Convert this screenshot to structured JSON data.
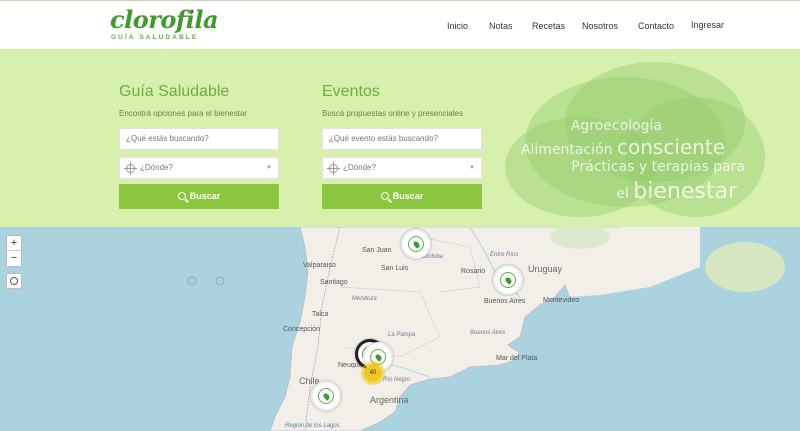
{
  "brand": {
    "name": "clorofila",
    "tagline": "GUÍA SALUDABLE",
    "color": "#3f9a2d"
  },
  "nav": {
    "items": [
      "Inicio",
      "Notas",
      "Recetas",
      "Nosotros",
      "Contacto",
      "Ingresar"
    ]
  },
  "guide": {
    "title": "Guía Saludable",
    "subtitle": "Encontrá opciones para el bienestar",
    "search_placeholder": "¿Qué estás buscando?",
    "where_placeholder": "¿Dónde?",
    "button": "Buscar"
  },
  "events": {
    "title": "Eventos",
    "subtitle": "Buscá propuestas online y presenciales",
    "search_placeholder": "¿Qué evento estás buscando?",
    "where_placeholder": "¿Dónde?",
    "button": "Buscar"
  },
  "hero_quote": {
    "line1": "Agroecología",
    "line2a": "Alimentación ",
    "line2b": "consciente",
    "line3": "Prácticas y terapias para",
    "line4a": "el ",
    "line4b": "bienestar"
  },
  "map": {
    "zoom_in": "+",
    "zoom_out": "−",
    "labels": {
      "san_juan": "San Juan",
      "cordoba": "Córdoba",
      "valparaiso": "Valparaíso",
      "san_luis": "San Luis",
      "rosario": "Rosario",
      "entre_rios": "Entre Ríos",
      "uruguay": "Uruguay",
      "santiago": "Santiago",
      "mendoza": "Mendoza",
      "buenos_aires": "Buenos Aires",
      "montevideo": "Montevideo",
      "talca": "Talca",
      "concepcion": "Concepción",
      "la_pampa": "La Pampa",
      "buenos_aires_prov": "Buenos Aires",
      "mar_del_plata": "Mar del Plata",
      "neuquen": "Neuquén",
      "chile": "Chile",
      "argentina": "Argentina",
      "rio_negro": "Río Negro",
      "los_lagos": "Región de los Lagos"
    },
    "cluster_count": "40",
    "colors": {
      "water": "#aad3df",
      "land": "#f2efe9",
      "accent": "#8cc63f"
    }
  }
}
